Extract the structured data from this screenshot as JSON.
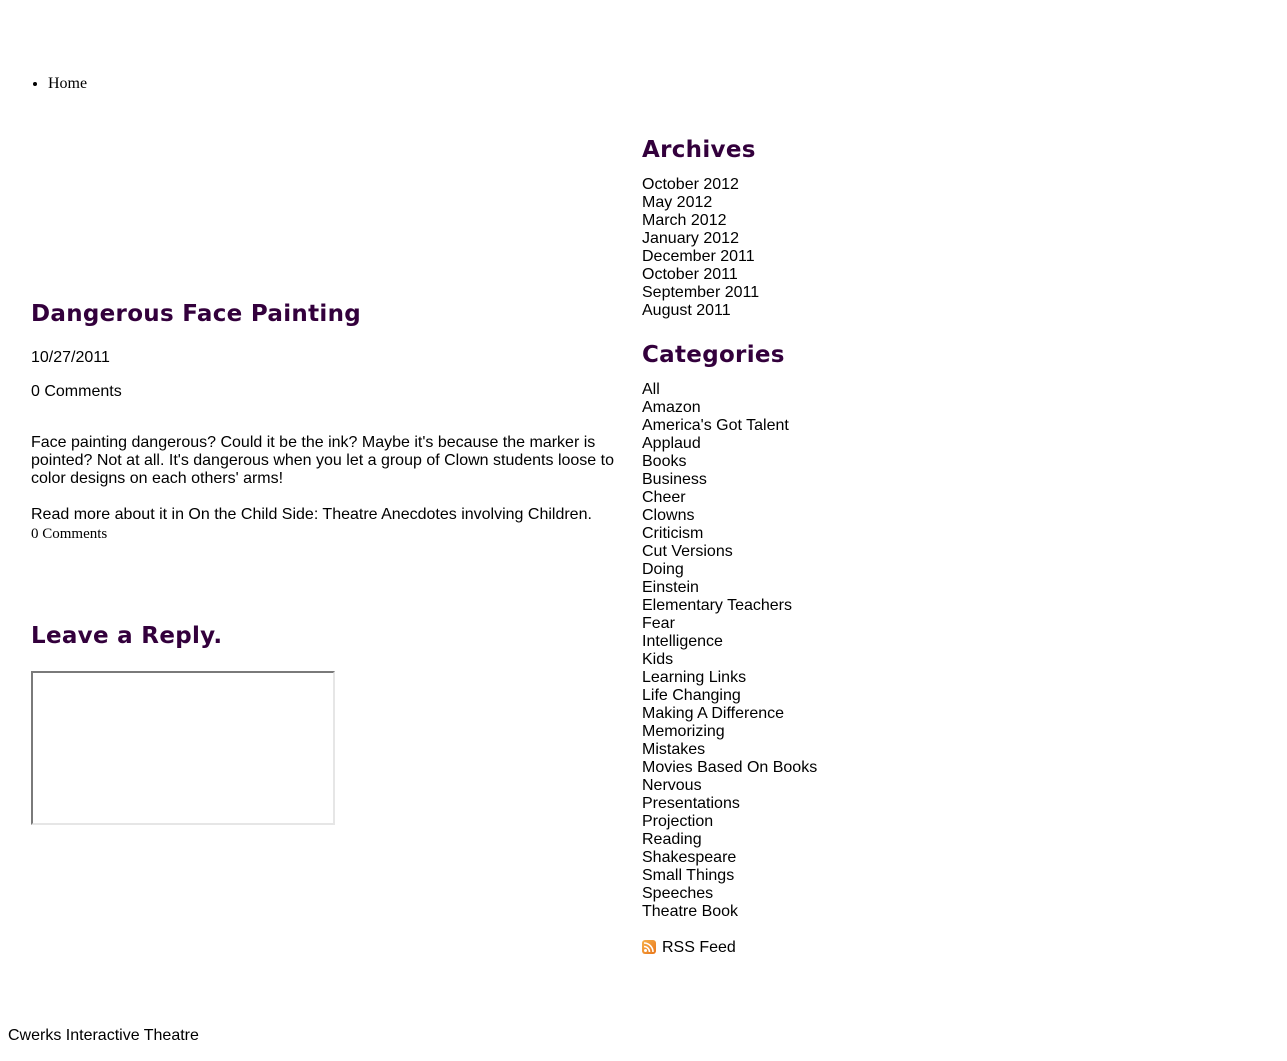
{
  "nav": {
    "items": [
      {
        "label": "Home"
      }
    ]
  },
  "post": {
    "title": "Dangerous Face Painting",
    "date": "10/27/2011",
    "comments_top": "0 Comments",
    "paragraphs": [
      "Face painting dangerous? Could it be the ink? Maybe it's because the marker is pointed? Not at all. It's dangerous when you let a group of Clown students loose to color designs on each others' arms!",
      "Read more about it in On the Child Side: Theatre Anecdotes involving Children."
    ],
    "comments_bottom": "0 Comments"
  },
  "reply": {
    "title": "Leave a Reply."
  },
  "sidebar": {
    "archives_heading": "Archives",
    "archives": [
      "October 2012",
      "May 2012",
      "March 2012",
      "January 2012",
      "December 2011",
      "October 2011",
      "September 2011",
      "August 2011"
    ],
    "categories_heading": "Categories",
    "categories": [
      "All",
      "Amazon",
      "America's Got Talent",
      "Applaud",
      "Books",
      "Business",
      "Cheer",
      "Clowns",
      "Criticism",
      "Cut Versions",
      "Doing",
      "Einstein",
      "Elementary Teachers",
      "Fear",
      "Intelligence",
      "Kids",
      "Learning Links",
      "Life Changing",
      "Making A Difference",
      "Memorizing",
      "Mistakes",
      "Movies Based On Books",
      "Nervous",
      "Presentations",
      "Projection",
      "Reading",
      "Shakespeare",
      "Small Things",
      "Speeches",
      "Theatre Book"
    ],
    "rss_label": "RSS Feed",
    "rss_icon": "rss-feed-icon"
  },
  "footer": {
    "text": "Cwerks Interactive Theatre"
  },
  "colors": {
    "heading": "#33003c",
    "text": "#000000",
    "background": "#ffffff",
    "rss_orange": "#e8751a"
  }
}
